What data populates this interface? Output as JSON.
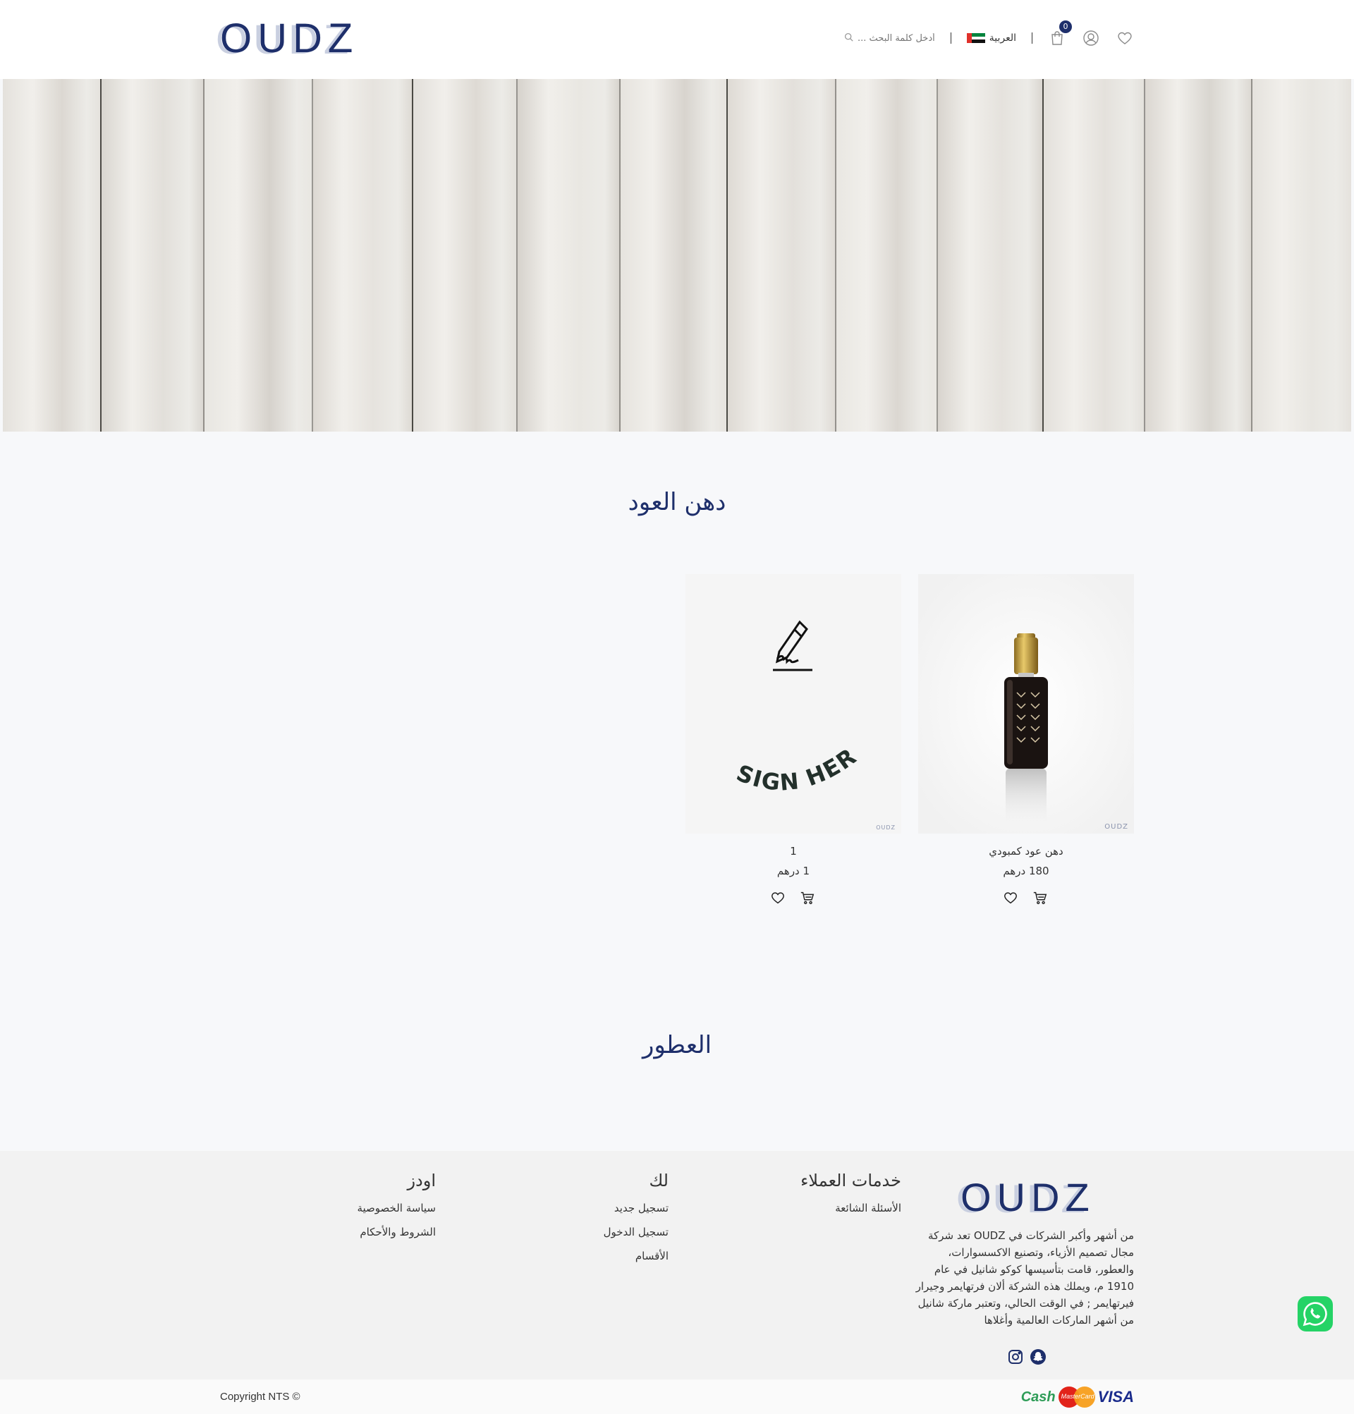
{
  "brand": {
    "logo_text": "OUDZ"
  },
  "header": {
    "search_placeholder": "أدخل كلمة البحث ...",
    "language_label": "العربية",
    "cart_count": "0"
  },
  "sections": [
    {
      "title": "دهن العود"
    },
    {
      "title": "العطور"
    }
  ],
  "products": [
    {
      "name": "دهن عود كمبودي",
      "price": "180 درهم",
      "watermark": "OUDZ"
    },
    {
      "name": "1",
      "price": "1 درهم",
      "image_text": "SIGN HERE",
      "watermark": "OUDZ"
    }
  ],
  "footer": {
    "about": "من أشهر وأكبر الشركات في OUDZ تعد شركة مجال تصميم الأزياء، وتصنيع الاكسسوارات، والعطور، قامت بتأسيسها كوكو شانيل في عام 1910 م، ويملك هذه الشركة ألان فرتهايمر وجيرار فيرتهايمر ; في الوقت الحالي، وتعتبر ماركة شانيل من أشهر الماركات العالمية وأغلاها",
    "columns": [
      {
        "heading": "خدمات العملاء",
        "links": [
          "الأسئلة الشائعة"
        ]
      },
      {
        "heading": "لك",
        "links": [
          "تسجيل جديد",
          "تسجيل الدخول",
          "الأقسام"
        ]
      },
      {
        "heading": "اودز",
        "links": [
          "سياسة الخصوصية",
          "الشروط والأحكام"
        ]
      }
    ],
    "copyright": "Copyright NTS ©",
    "payments": {
      "cash": "Cash",
      "mastercard": "MasterCard",
      "visa": "VISA"
    }
  },
  "colors": {
    "brand_navy": "#1e2f6b",
    "whatsapp_green": "#25d366"
  },
  "icons": [
    "heart-icon",
    "user-icon",
    "cart-icon",
    "search-icon",
    "instagram-icon",
    "snapchat-icon",
    "whatsapp-icon"
  ]
}
